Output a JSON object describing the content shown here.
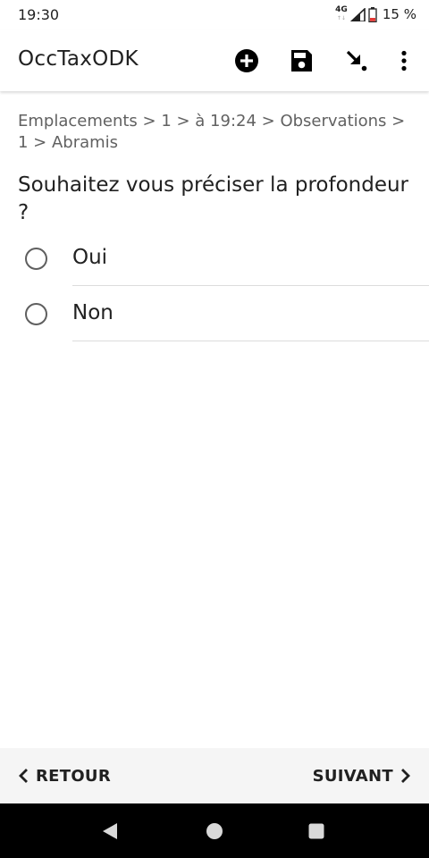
{
  "status_bar": {
    "time": "19:30",
    "network_type": "4G",
    "battery_percent": "15 %"
  },
  "app_bar": {
    "title": "OccTaxODK",
    "actions": [
      {
        "icon": "add-circle-icon"
      },
      {
        "icon": "save-icon"
      },
      {
        "icon": "jump-to-question-icon"
      },
      {
        "icon": "more-vert-icon"
      }
    ]
  },
  "form": {
    "breadcrumb": "Emplacements > 1 > à 19:24 > Observations > 1 > Abramis",
    "question": "Souhaitez vous préciser la profondeur ?",
    "choices": [
      {
        "label": "Oui",
        "selected": false
      },
      {
        "label": "Non",
        "selected": false
      }
    ]
  },
  "bottom_nav": {
    "prev_label": "RETOUR",
    "next_label": "SUIVANT"
  },
  "system_nav": {
    "buttons": [
      "back-icon",
      "home-icon",
      "recents-icon"
    ]
  },
  "colors": {
    "background": "#ffffff",
    "text_primary": "#212121",
    "text_secondary": "#616161",
    "bottom_nav_bg": "#f5f5f5",
    "system_nav_bg": "#000000",
    "battery_low": "#e53935"
  }
}
